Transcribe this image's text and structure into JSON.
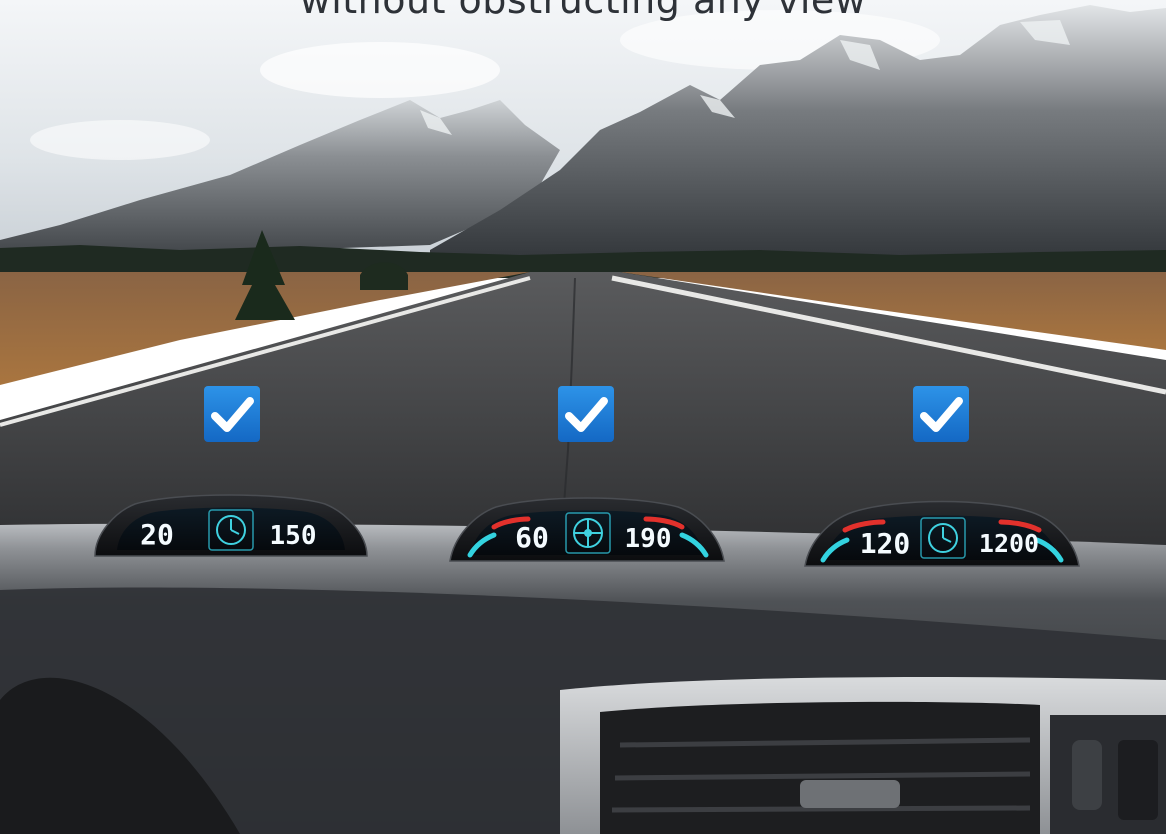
{
  "headline": "without obstructing any view",
  "colors": {
    "sky": "#e6ebef",
    "road": "#3a3b3d",
    "grass": "#9c6b42",
    "dashboard": "#2a2c2f",
    "check_blue": "#1f7fd6",
    "hud_cyan": "#33d3e0",
    "hud_red": "#e2312c"
  },
  "checkmarks": [
    {
      "icon": "checkmark-icon"
    },
    {
      "icon": "checkmark-icon"
    },
    {
      "icon": "checkmark-icon"
    }
  ],
  "hud_displays": [
    {
      "speed": "20",
      "value": "150",
      "accent_bars": false,
      "icon": "compass-icon"
    },
    {
      "speed": "60",
      "value": "190",
      "accent_bars": true,
      "icon": "crosshair-icon"
    },
    {
      "speed": "120",
      "value": "1200",
      "accent_bars": true,
      "icon": "compass-icon"
    }
  ]
}
